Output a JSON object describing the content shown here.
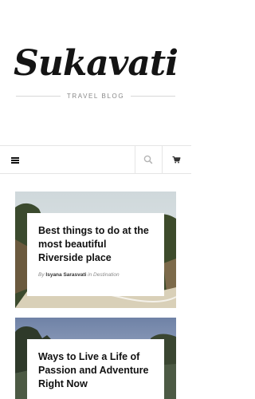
{
  "site": {
    "logo_text": "Sukavati",
    "tagline": "TRAVEL BLOG"
  },
  "nav": {
    "menu_icon": "hamburger-icon",
    "search_icon": "search-icon",
    "cart_icon": "cart-icon"
  },
  "posts": [
    {
      "title": "Best things to do at the most beautiful Riverside place",
      "by_label": "By",
      "author": "Isyana Sarasvati",
      "in_label": "in",
      "category": "Destination"
    },
    {
      "title": "Ways to Live a Life of Passion and Adventure Right Now",
      "by_label": "",
      "author": "",
      "in_label": "",
      "category": ""
    }
  ],
  "colors": {
    "text": "#111111",
    "muted": "#888888",
    "border": "#e5e5e5",
    "sea": "#2aa7b4"
  }
}
